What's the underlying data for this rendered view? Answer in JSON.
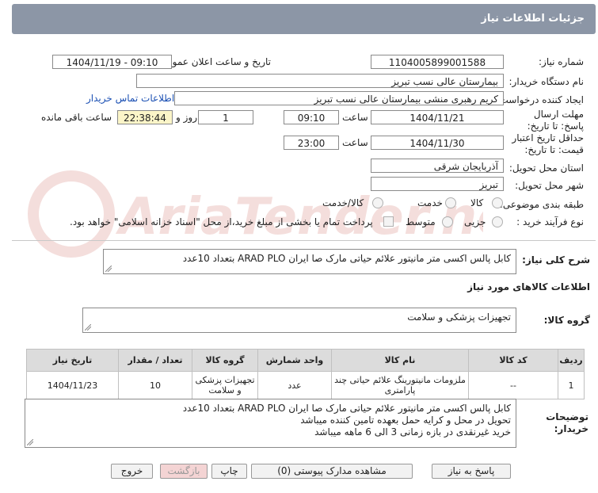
{
  "header": {
    "title": "جزئیات اطلاعات نیاز"
  },
  "fields": {
    "need_number_label": "شماره نیاز:",
    "need_number": "1104005899001588",
    "announce_label": "تاریخ و ساعت اعلان عمومی:",
    "announce_value": "1404/11/19 - 09:10",
    "buyer_org_label": "نام دستگاه خریدار:",
    "buyer_org": "بیمارستان عالی نسب تبریز",
    "creator_label": "ایجاد کننده درخواست:",
    "creator": "کریم رهبری منشی بیمارستان عالی نسب تبریز",
    "contact_link": "اطلاعات تماس خریدار",
    "deadline_label": "مهلت ارسال پاسخ: تا تاریخ:",
    "deadline_date": "1404/11/21",
    "time_label": "ساعت",
    "deadline_time": "09:10",
    "days": "1",
    "day_and_label": "روز و",
    "remaining": "22:38:44",
    "remaining_label": "ساعت باقی مانده",
    "validity_label": "حداقل تاریخ اعتبار قیمت: تا تاریخ:",
    "validity_date": "1404/11/30",
    "validity_time_label": "ساعت",
    "validity_time": "23:00",
    "province_label": "استان محل تحویل:",
    "province": "آذربایجان شرقی",
    "city_label": "شهر محل تحویل:",
    "city": "تبریز",
    "category_label": "طبقه بندی موضوعی:",
    "cat_goods": "کالا",
    "cat_service": "خدمت",
    "cat_both": "کالا/خدمت",
    "process_label": "نوع فرآیند خرید :",
    "proc_partial": "جزیی",
    "proc_medium": "متوسط",
    "payment_note": "پرداخت تمام یا بخشی از مبلغ خرید،از محل \"اسناد خزانه اسلامی\" خواهد بود."
  },
  "summary": {
    "label": "شرح کلی نیاز:",
    "text": "کابل پالس اکسی متر مانیتور علائم حیاتی مارک صا ایران ARAD PLO بتعداد 10عدد"
  },
  "goods": {
    "section_title": "اطلاعات کالاهای مورد نیاز",
    "group_label": "گروه کالا:",
    "group_value": "تجهیزات پزشکی و سلامت"
  },
  "table": {
    "headers": [
      "ردیف",
      "کد کالا",
      "نام کالا",
      "واحد شمارش",
      "گروه کالا",
      "تعداد / مقدار",
      "تاریخ نیاز"
    ],
    "rows": [
      [
        "1",
        "--",
        "ملزومات مانیتورینگ علائم حیاتی چند پارامتری",
        "عدد",
        "تجهیزات پزشکی و سلامت",
        "10",
        "1404/11/23"
      ]
    ]
  },
  "buyer_notes": {
    "label": "توضیحات خریدار:",
    "lines": [
      "کابل پالس اکسی متر مانیتور علائم حیاتی مارک صا ایران ARAD PLO بتعداد 10عدد",
      "تحویل در محل و کرایه حمل بعهده تامین کننده میباشد",
      "خرید غیرنقدی در بازه زمانی 3 الی 6 ماهه میباشد"
    ]
  },
  "buttons": {
    "reply": "پاسخ به نیاز",
    "attachments": "مشاهده مدارک پیوستی (0)",
    "print": "چاپ",
    "back": "بازگشت",
    "exit": "خروج"
  },
  "watermark": {
    "text": "AriaTender.neT"
  }
}
